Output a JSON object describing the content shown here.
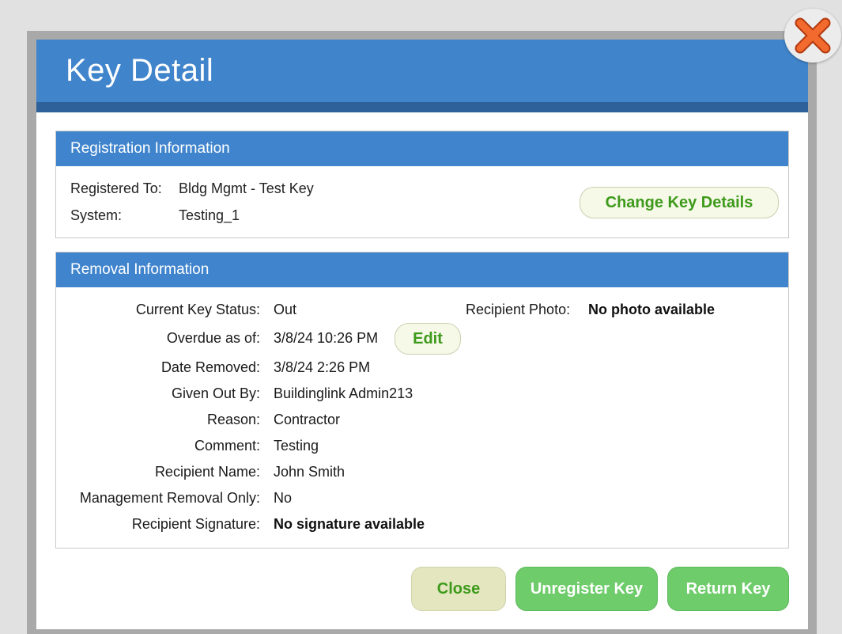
{
  "modal": {
    "title": "Key Detail"
  },
  "registration": {
    "header": "Registration Information",
    "registered_to_label": "Registered To:",
    "registered_to_value": "Bldg Mgmt - Test Key",
    "system_label": "System:",
    "system_value": "Testing_1",
    "change_button": "Change Key Details"
  },
  "removal": {
    "header": "Removal Information",
    "fields": [
      {
        "label": "Current Key Status:",
        "value": "Out"
      },
      {
        "label": "Overdue as of:",
        "value": "3/8/24 10:26 PM"
      },
      {
        "label": "Date Removed:",
        "value": "3/8/24 2:26 PM"
      },
      {
        "label": "Given Out By:",
        "value": "Buildinglink Admin213"
      },
      {
        "label": "Reason:",
        "value": "Contractor"
      },
      {
        "label": "Comment:",
        "value": "Testing"
      },
      {
        "label": "Recipient Name:",
        "value": "John Smith"
      },
      {
        "label": "Management Removal Only:",
        "value": "No"
      },
      {
        "label": "Recipient Signature:",
        "value": "No signature available"
      }
    ],
    "edit_button": "Edit",
    "photo_label": "Recipient Photo:",
    "photo_value": "No photo available"
  },
  "footer": {
    "close": "Close",
    "unregister": "Unregister Key",
    "return": "Return Key"
  },
  "icons": {
    "close": "close-x-icon"
  },
  "colors": {
    "header_blue": "#4085cc",
    "header_dark": "#2e619a",
    "green_button": "#6ecc6a",
    "green_text": "#3d9a1a"
  }
}
